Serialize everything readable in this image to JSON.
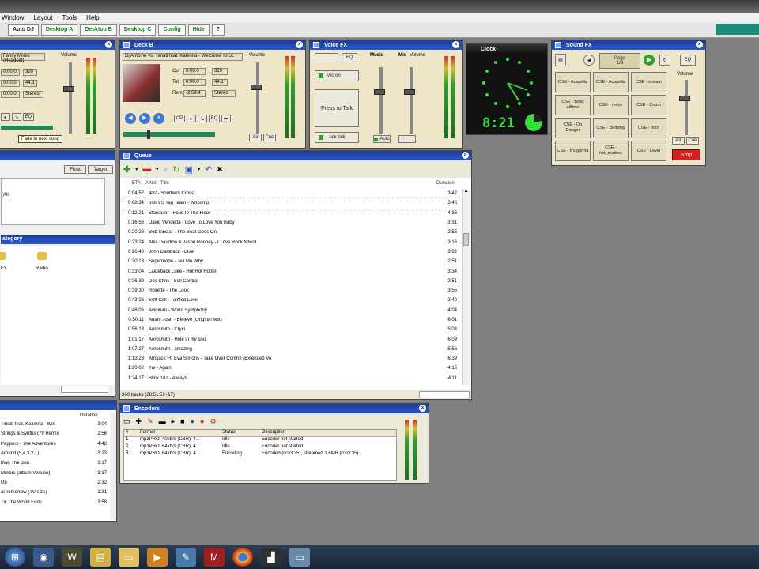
{
  "menu": [
    "Window",
    "Layout",
    "Tools",
    "Help"
  ],
  "toolbar": {
    "auto_dj": "Auto DJ",
    "desktop_a": "Desktop A",
    "desktop_b": "Desktop B",
    "desktop_c": "Desktop C",
    "config": "Config",
    "hide": "Hide",
    "help": "?"
  },
  "deck_a": {
    "title_field": "Fancy Mixes (Headset)",
    "volume_label": "Volume",
    "tooltip": "Fade to next song",
    "fields": [
      "0:00:0",
      "0:00:0",
      "0:00:0"
    ],
    "stats": [
      "320",
      "44.1",
      "Stereo"
    ]
  },
  "deck_b": {
    "title": "Deck B",
    "track": "Dj Antoine vs. Timati feat. Kalenna - Welcome To St.",
    "volume_label": "Volume",
    "fields": [
      "Cur",
      "Tot",
      "Rem"
    ],
    "times": [
      "0:00.0",
      "0:00.0",
      "-2:59.4"
    ],
    "stats": [
      "320",
      "44.1",
      "Stereo"
    ],
    "buttons": [
      "CP",
      "EQ"
    ],
    "bottom": [
      "Air",
      "Cue"
    ]
  },
  "voice_fx": {
    "title": "Voice FX",
    "eq": "EQ",
    "music": "Music",
    "mic": "Mic",
    "volume": "Volume",
    "mic_on": "Mic on",
    "press_to_talk": "Press to Talk",
    "lock_talk": "Lock talk",
    "auto": "Auto"
  },
  "clock": {
    "title": "Clock",
    "digital": "8:21"
  },
  "sound_fx": {
    "title": "Sound FX",
    "page": "Page",
    "page_num": "1/3",
    "eq": "EQ",
    "volume": "Volume",
    "air": "Air",
    "cue": "Cue",
    "stop": "Stop",
    "pads": [
      [
        "CSE - Acapella",
        "CSE - Acapella",
        "CSE - stream"
      ],
      [
        "CSE - Bday alltime",
        "CSE - remix",
        "CSE - Count"
      ],
      [
        "CSE - On Danger",
        "CSE - Birthday",
        "CSE - Intro"
      ],
      [
        "CSE - It's gonna",
        "CSE - hot_matters",
        "CSE - Level"
      ]
    ]
  },
  "queue": {
    "title": "Queue",
    "cols": {
      "eta": "ETA",
      "title": "Artist - Title",
      "duration": "Duration"
    },
    "rows": [
      {
        "eta": "0:04:52",
        "title": "402 - Southern Cross",
        "dur": "3:42"
      },
      {
        "eta": "0:08:34",
        "title": "666 VS Tag Team - Whoomp",
        "dur": "3:46"
      },
      {
        "eta": "0:12:21",
        "title": "Starsailor - Four To The Floor",
        "dur": "4:35"
      },
      {
        "eta": "0:16:56",
        "title": "David Vendetta - Love To Love You Baby",
        "dur": "3:31"
      },
      {
        "eta": "0:20:28",
        "title": "Bob Sinclar - The Beat Goes On",
        "dur": "2:55"
      },
      {
        "eta": "0:23:24",
        "title": "Alex Gaudino & Jason Rooney - I Love Rock N'Roll",
        "dur": "3:16"
      },
      {
        "eta": "0:26:40",
        "title": "John Dahlback - Blink",
        "dur": "3:32"
      },
      {
        "eta": "0:30:13",
        "title": "Supermode - Tell Me Why",
        "dur": "2:51"
      },
      {
        "eta": "0:33:04",
        "title": "Laideback Luke - Hot Hot Hotter",
        "dur": "3:34"
      },
      {
        "eta": "0:36:39",
        "title": "Des Chris - Sell Control",
        "dur": "2:51"
      },
      {
        "eta": "0:39:30",
        "title": "Roxette - The Look",
        "dur": "3:55"
      },
      {
        "eta": "0:43:26",
        "title": "Soft Cell - Tainted Love",
        "dur": "2:40"
      },
      {
        "eta": "0:46:06",
        "title": "Avidinan - World Symphony",
        "dur": "4:04"
      },
      {
        "eta": "0:50:11",
        "title": "Adam Joan - Believe (Original Mix)",
        "dur": "6:01"
      },
      {
        "eta": "0:56:13",
        "title": "Aerosmith - Cryin",
        "dur": "5:03"
      },
      {
        "eta": "1:01:17",
        "title": "Aerosmith - Hole in my soul",
        "dur": "6:09"
      },
      {
        "eta": "1:07:27",
        "title": "Aerosmith - amazing",
        "dur": "5:56"
      },
      {
        "eta": "1:13:23",
        "title": "Afrojack Ft. Eva Simons - Take Over Control (Extended Ve",
        "dur": "6:39"
      },
      {
        "eta": "1:20:02",
        "title": "Yui - Again",
        "dur": "4:15"
      },
      {
        "eta": "1:24:17",
        "title": "Blink 182 - Always",
        "dur": "4:11"
      }
    ],
    "footer": "360 tracks (28:51:59+17)"
  },
  "left_panel": {
    "buttons": [
      "Float",
      "Target"
    ],
    "item_all": "(All)",
    "category_header": "ategory",
    "folders": [
      "FX",
      "Radio"
    ]
  },
  "history": {
    "header": "Duration",
    "rows": [
      {
        "title": "Timati feat. Kalenna - Wel",
        "dur": "3:04"
      },
      {
        "title": "Strings & Synths (79 Remix",
        "dur": "2:56"
      },
      {
        "title": "Peppers - The Adventures",
        "dur": "4:42"
      },
      {
        "title": "Around (5,4,3,2,1)",
        "dur": "3:23"
      },
      {
        "title": "than The Sun",
        "dur": "3:17"
      },
      {
        "title": "Mirrors (album Version)",
        "dur": "3:17"
      },
      {
        "title": "Up",
        "dur": "2:32"
      },
      {
        "title": "al Tomorrow (TV size)",
        "dur": "1:31"
      },
      {
        "title": "Till The World Ends",
        "dur": "3:58"
      }
    ]
  },
  "encoders": {
    "title": "Encoders",
    "cols": [
      "#",
      "Format",
      "Status",
      "Description"
    ],
    "rows": [
      {
        "n": "1",
        "format": "mp3PRO: 40kb/s (CBR), 4...",
        "status": "Idle",
        "desc": "Encoder not started"
      },
      {
        "n": "2",
        "format": "mp3PRO: 64kb/s (CBR), 4...",
        "status": "Idle",
        "desc": "Encoder not started"
      },
      {
        "n": "3",
        "format": "mp3PRO: 64kb/s (CBR), 4...",
        "status": "Encoding",
        "desc": "Encoded (0:03:35), streamed 1.6MB (0:03:35)"
      }
    ]
  },
  "colors": {
    "title_blue": "#1c3f9c",
    "panel_tan": "#efe6c9",
    "accent_teal": "#1d8a7a",
    "clock_green": "#35e035"
  }
}
